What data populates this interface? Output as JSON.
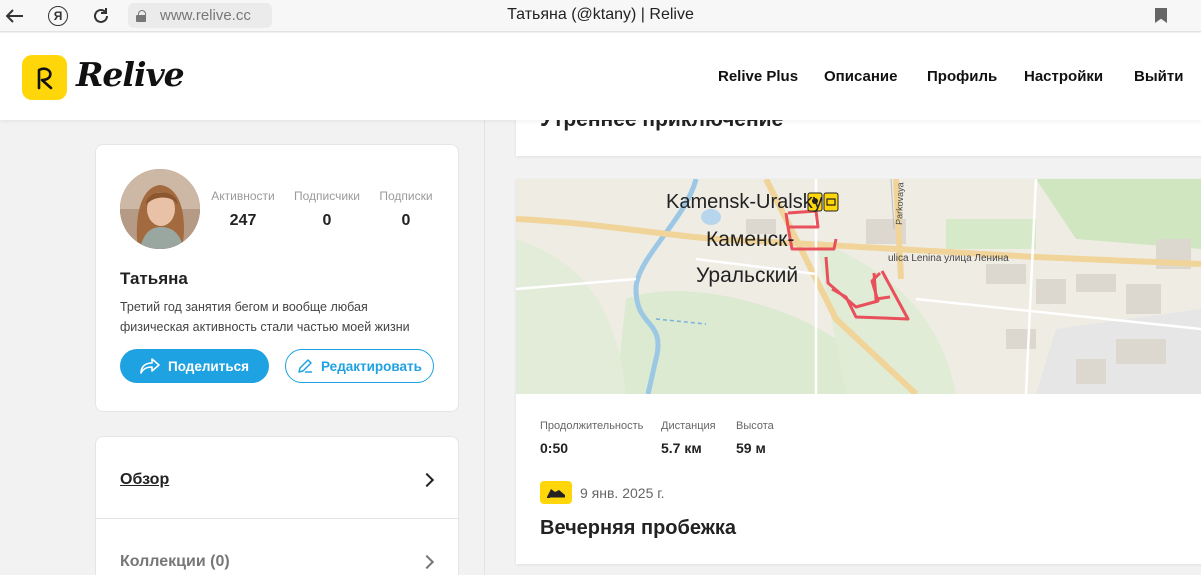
{
  "browser": {
    "url": "www.relive.cc",
    "tab_title": "Татьяна (@ktany) | Relive"
  },
  "header": {
    "logo_text": "Relive",
    "nav": [
      "Relive Plus",
      "Описание",
      "Профиль",
      "Настройки",
      "Выйти"
    ]
  },
  "profile": {
    "name": "Татьяна",
    "bio": "Третий год занятия бегом и вообще любая физическая активность стали частью моей жизни",
    "stats": [
      {
        "label": "Активности",
        "value": "247"
      },
      {
        "label": "Подписчики",
        "value": "0"
      },
      {
        "label": "Подписки",
        "value": "0"
      }
    ],
    "share_label": "Поделиться",
    "edit_label": "Редактировать"
  },
  "menu": [
    {
      "label": "Обзор"
    },
    {
      "label": "Коллекции (0)"
    }
  ],
  "feed": {
    "previous_title": "Утреннее приключение",
    "activity": {
      "map_labels": {
        "city_en": "Kamensk-Uralsky",
        "city_ru_line1": "Каменск-",
        "city_ru_line2": "Уральский",
        "street": "ulica Lenina улица Ленина",
        "street2": "Parkovaya"
      },
      "stats": [
        {
          "label": "Продолжительность",
          "value": "0:50"
        },
        {
          "label": "Дистанция",
          "value": "5.7 км"
        },
        {
          "label": "Высота",
          "value": "59 м"
        }
      ],
      "date": "9 янв. 2025 г.",
      "title": "Вечерняя пробежка",
      "icon": "running-shoe-icon",
      "route_color": "#e8505b"
    }
  },
  "colors": {
    "brand_yellow": "#ffd60a",
    "accent_blue": "#1fa2e1"
  }
}
